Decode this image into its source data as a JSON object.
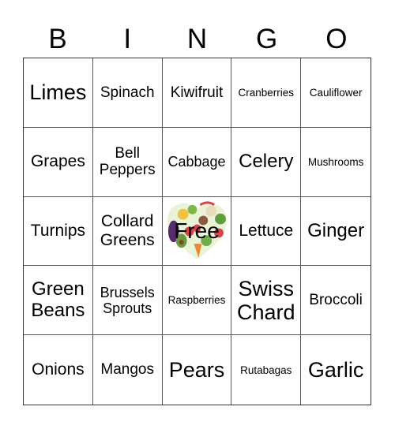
{
  "header": [
    "B",
    "I",
    "N",
    "G",
    "O"
  ],
  "cells": [
    "Limes",
    "Spinach",
    "Kiwifruit",
    "Cranberries",
    "Cauliflower",
    "Grapes",
    "Bell Peppers",
    "Cabbage",
    "Celery",
    "Mushrooms",
    "Turnips",
    "Collard Greens",
    "Free",
    "Lettuce",
    "Ginger",
    "Green Beans",
    "Brussels Sprouts",
    "Raspberries",
    "Swiss Chard",
    "Broccoli",
    "Onions",
    "Mangos",
    "Pears",
    "Rutabagas",
    "Garlic"
  ],
  "free_space": {
    "label": "Free",
    "image": "vegetable-heart-icon"
  }
}
